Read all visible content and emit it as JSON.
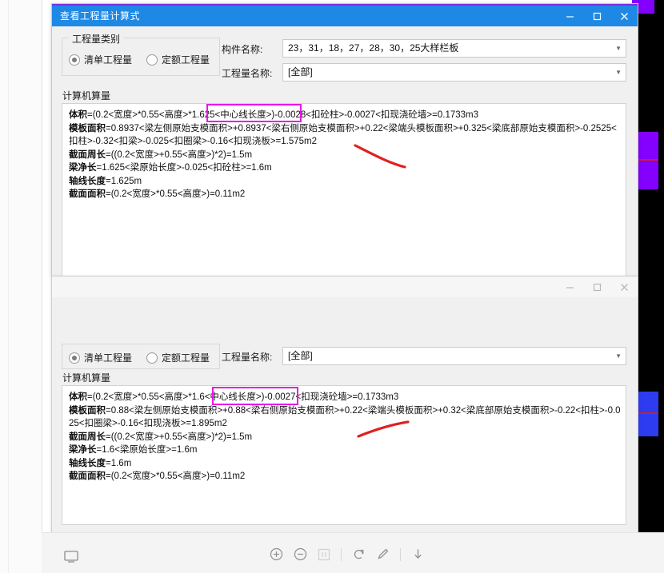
{
  "window1": {
    "title": "查看工程量计算式",
    "controls": {
      "minimize": "–",
      "maximize": "□",
      "close": "×"
    },
    "category_group": {
      "legend": "工程量类别",
      "options": [
        {
          "label": "清单工程量",
          "selected": true
        },
        {
          "label": "定额工程量",
          "selected": false
        }
      ]
    },
    "fields": [
      {
        "label": "构件名称:",
        "value": "23，31，18，27，28，30，25大样栏板"
      },
      {
        "label": "工程量名称:",
        "value": "[全部]"
      }
    ],
    "section_label": "计算机算量",
    "formula_lines": [
      {
        "bold": "体积",
        "text": "=(0.2<宽度>*0.55<高度>*1.625<中心线长度>)-0.0028<扣砼柱>-0.0027<扣现浇砼墙>=0.1733m3"
      },
      {
        "bold": "模板面积",
        "text": "=0.8937<梁左侧原始支模面积>+0.8937<梁右侧原始支模面积>+0.22<梁端头模板面积>+0.325<梁底部原始支模面积>-0.2525<扣柱>-0.32<扣梁>-0.025<扣圈梁>-0.16<扣现浇板>=1.575m2"
      },
      {
        "bold": "截面周长",
        "text": "=((0.2<宽度>+0.55<高度>)*2)=1.5m"
      },
      {
        "bold": "梁净长",
        "text": "=1.625<梁原始长度>-0.025<扣砼柱>=1.6m"
      },
      {
        "bold": "轴线长度",
        "text": "=1.625m"
      },
      {
        "bold": "截面面积",
        "text": "=(0.2<宽度>*0.55<高度>)=0.11m2"
      }
    ],
    "highlight_text": "*1.625<中心线长度>"
  },
  "window2": {
    "controls": {
      "minimize": "–",
      "maximize": "□",
      "close": "×"
    },
    "category_group": {
      "options": [
        {
          "label": "清单工程量",
          "selected": true
        },
        {
          "label": "定额工程量",
          "selected": false
        }
      ]
    },
    "fields": [
      {
        "label": "工程量名称:",
        "value": "[全部]"
      }
    ],
    "section_label": "计算机算量",
    "formula_lines": [
      {
        "bold": "体积",
        "text": "=(0.2<宽度>*0.55<高度>*1.6<中心线长度>)-0.0027<扣现浇砼墙>=0.1733m3"
      },
      {
        "bold": "模板面积",
        "text": "=0.88<梁左侧原始支模面积>+0.88<梁右侧原始支模面积>+0.22<梁端头模板面积>+0.32<梁底部原始支模面积>-0.22<扣柱>-0.025<扣圈梁>-0.16<扣现浇板>=1.895m2"
      },
      {
        "bold": "截面周长",
        "text": "=((0.2<宽度>+0.55<高度>)*2)=1.5m"
      },
      {
        "bold": "梁净长",
        "text": "=1.6<梁原始长度>=1.6m"
      },
      {
        "bold": "轴线长度",
        "text": "=1.6m"
      },
      {
        "bold": "截面面积",
        "text": "=(0.2<宽度>*0.55<高度>)=0.11m2"
      }
    ],
    "highlight_text": "1.6<中心线长度>"
  },
  "toolbar": {
    "icons": [
      {
        "name": "monitor-icon"
      },
      {
        "name": "zoom-in-icon"
      },
      {
        "name": "zoom-out-icon"
      },
      {
        "name": "fit-page-icon"
      },
      {
        "name": "rotate-icon"
      },
      {
        "name": "pen-icon"
      },
      {
        "name": "download-icon"
      }
    ]
  },
  "colors": {
    "titlebar_active": "#1e88e5",
    "accent_purple": "#7a2fe0",
    "highlight_magenta": "#e816e8",
    "annotation_red": "#e02020",
    "swatch_purple": "#8400ff",
    "swatch_blue": "#2d3cf0"
  }
}
